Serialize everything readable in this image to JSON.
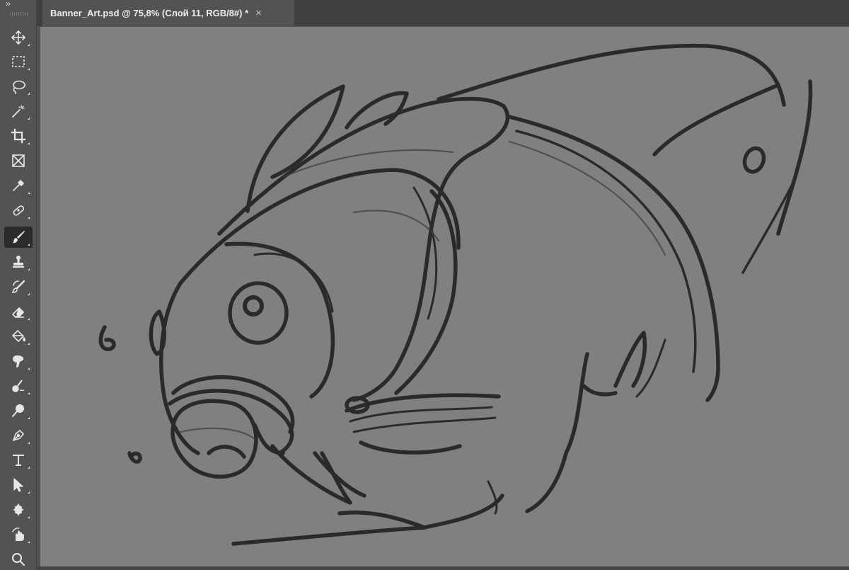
{
  "toolbar": {
    "collapse_glyph": "››",
    "tools": [
      {
        "id": "move",
        "icon": "move-icon"
      },
      {
        "id": "marquee",
        "icon": "rectangular-marquee-icon"
      },
      {
        "id": "lasso",
        "icon": "lasso-icon"
      },
      {
        "id": "magic-wand",
        "icon": "magic-wand-icon"
      },
      {
        "id": "crop",
        "icon": "crop-icon"
      },
      {
        "id": "frame",
        "icon": "frame-icon"
      },
      {
        "id": "eyedropper",
        "icon": "eyedropper-icon"
      },
      {
        "id": "healing",
        "icon": "spot-healing-brush-icon"
      },
      {
        "id": "brush",
        "icon": "brush-icon",
        "active": true
      },
      {
        "id": "stamp",
        "icon": "clone-stamp-icon"
      },
      {
        "id": "history-brush",
        "icon": "history-brush-icon"
      },
      {
        "id": "eraser",
        "icon": "eraser-icon"
      },
      {
        "id": "paint-bucket",
        "icon": "paint-bucket-icon"
      },
      {
        "id": "smudge",
        "icon": "smudge-icon"
      },
      {
        "id": "dodge",
        "icon": "dodge-icon"
      },
      {
        "id": "zoom-burn",
        "icon": "burn-icon"
      },
      {
        "id": "pen",
        "icon": "pen-icon"
      },
      {
        "id": "type",
        "icon": "type-icon"
      },
      {
        "id": "path-select",
        "icon": "path-selection-icon"
      },
      {
        "id": "shape",
        "icon": "custom-shape-icon"
      },
      {
        "id": "hand-rotate",
        "icon": "rotate-view-icon"
      },
      {
        "id": "zoom",
        "icon": "zoom-icon"
      }
    ]
  },
  "document": {
    "tab_title": "Banner_Art.psd @ 75,8% (Слой 11, RGB/8#) *",
    "close_glyph": "×"
  },
  "colors": {
    "ui_background": "#535353",
    "tab_bar": "#404040",
    "canvas": "#808080",
    "sketch_stroke": "#2a2a2a"
  }
}
